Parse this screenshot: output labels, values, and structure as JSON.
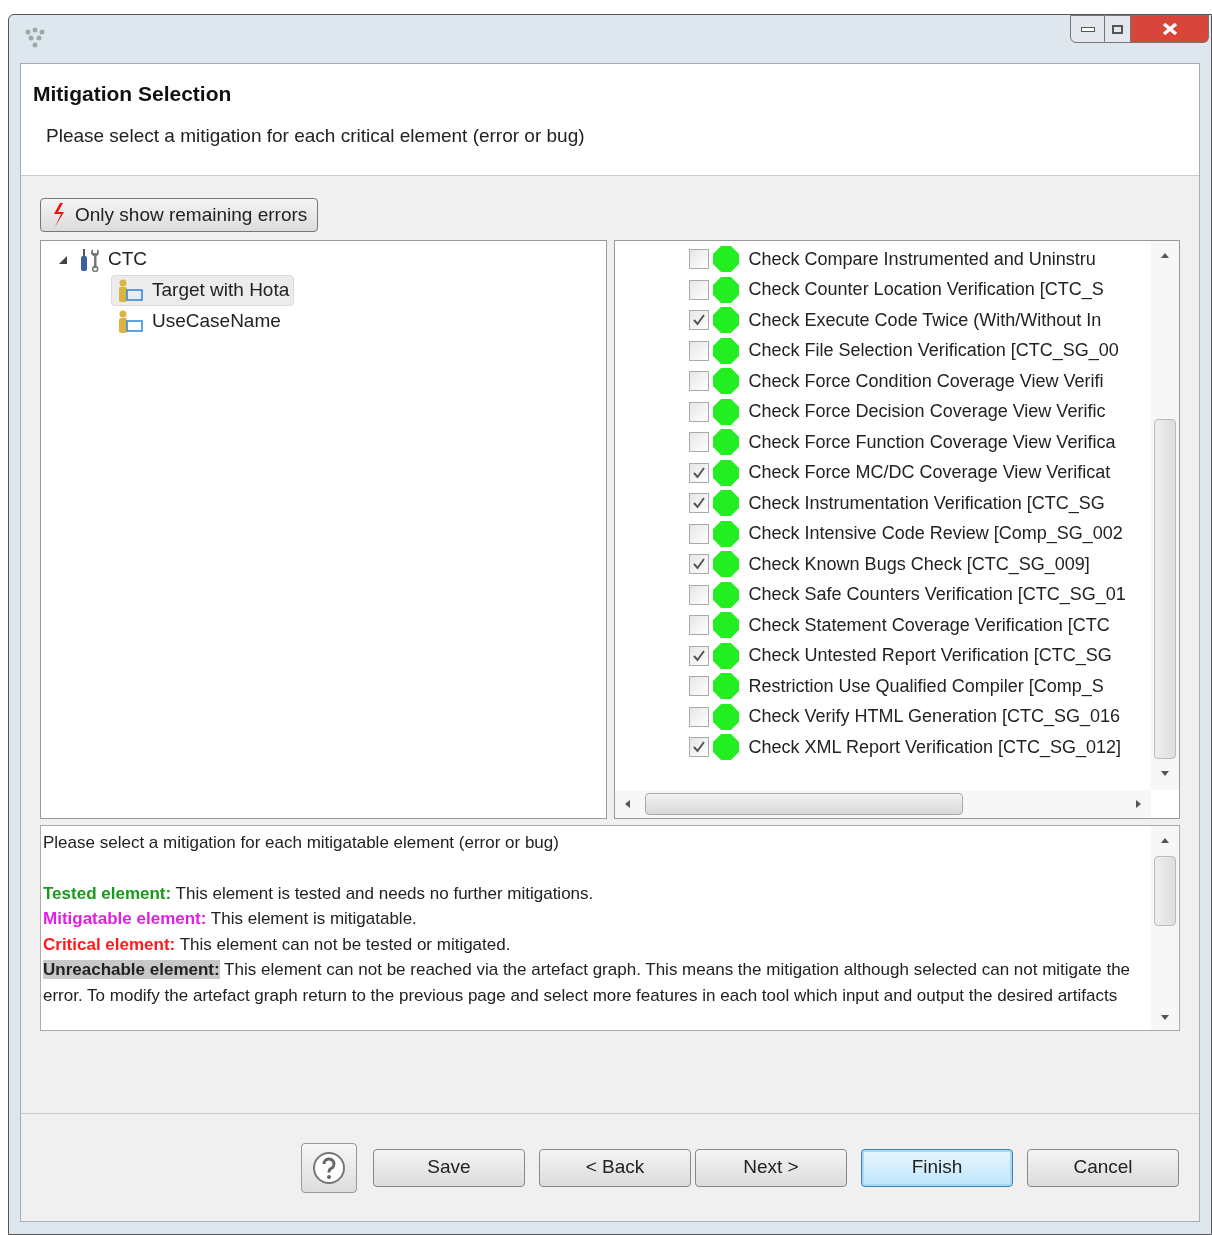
{
  "header": {
    "title": "Mitigation Selection",
    "subtitle": "Please select a mitigation for each critical element (error or bug)"
  },
  "filter_button": {
    "label": "Only show remaining errors"
  },
  "tree": [
    {
      "label": "CTC",
      "expanded": true,
      "kind": "tool",
      "selected": false,
      "children": [
        {
          "label": "Target with Hota",
          "kind": "usecase",
          "selected": true
        },
        {
          "label": "UseCaseName",
          "kind": "usecase",
          "selected": false
        }
      ]
    }
  ],
  "checks": [
    {
      "label": "Check Compare Instrumented and Uninstru",
      "checked": false
    },
    {
      "label": "Check Counter Location Verification [CTC_S",
      "checked": false
    },
    {
      "label": "Check Execute Code Twice (With/Without In",
      "checked": true
    },
    {
      "label": "Check File Selection Verification [CTC_SG_00",
      "checked": false
    },
    {
      "label": "Check Force Condition Coverage View Verifi",
      "checked": false
    },
    {
      "label": "Check Force Decision Coverage View Verific",
      "checked": false
    },
    {
      "label": "Check Force Function Coverage View Verifica",
      "checked": false
    },
    {
      "label": "Check Force MC/DC Coverage View Verificat",
      "checked": true
    },
    {
      "label": "Check Instrumentation Verification [CTC_SG",
      "checked": true
    },
    {
      "label": "Check Intensive Code Review [Comp_SG_002",
      "checked": false
    },
    {
      "label": "Check Known Bugs Check [CTC_SG_009]",
      "checked": true
    },
    {
      "label": "Check Safe Counters Verification [CTC_SG_01",
      "checked": false
    },
    {
      "label": "Check Statement Coverage Verification [CTC",
      "checked": false
    },
    {
      "label": "Check Untested Report Verification [CTC_SG",
      "checked": true
    },
    {
      "label": "Restriction Use Qualified Compiler [Comp_S",
      "checked": false
    },
    {
      "label": "Check Verify HTML Generation [CTC_SG_016",
      "checked": false
    },
    {
      "label": "Check XML Report Verification [CTC_SG_012]",
      "checked": true
    }
  ],
  "description": {
    "intro": "Please select a mitigation for each mitigatable element (error or bug)",
    "legend": [
      {
        "kind": "colored",
        "color": "#1a9a1a",
        "label": "Tested element:",
        "text": "This element is tested and needs no further mitigations."
      },
      {
        "kind": "colored",
        "color": "#e020e0",
        "label": "Mitigatable element:",
        "text": "This element is mitigatable."
      },
      {
        "kind": "colored",
        "color": "#ff1a1a",
        "label": "Critical element:",
        "text": "This element can not be tested or mitigated."
      },
      {
        "kind": "highlighted",
        "label": "Unreachable element:",
        "text": "This element can not be reached via the artefact graph. This means the mitigation although selected can not mitigate the error. To modify the artefact graph return to the previous page and select more features in each tool which input and output the desired artifacts"
      }
    ]
  },
  "buttons": [
    {
      "label": "Save",
      "default": false
    },
    {
      "label": "< Back",
      "default": false
    },
    {
      "label": "Next >",
      "default": false
    },
    {
      "label": "Finish",
      "default": true
    },
    {
      "label": "Cancel",
      "default": false
    }
  ]
}
